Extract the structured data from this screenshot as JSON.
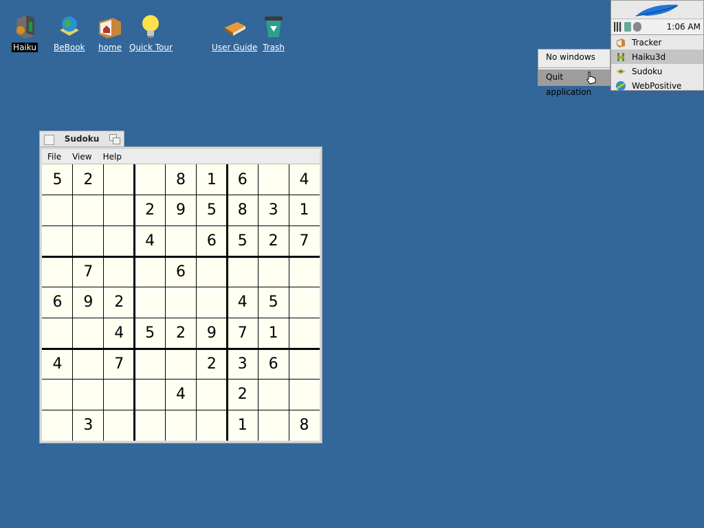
{
  "desktop": {
    "icons": [
      {
        "label": "Haiku",
        "icon": "haiku-volume-icon",
        "selected": true
      },
      {
        "label": "BeBook",
        "icon": "bebook-globe-icon"
      },
      {
        "label": "home",
        "icon": "home-folder-icon"
      },
      {
        "label": "Quick Tour",
        "icon": "lightbulb-icon"
      },
      {
        "label": "User Guide",
        "icon": "book-icon"
      },
      {
        "label": "Trash",
        "icon": "trash-icon"
      }
    ]
  },
  "deskbar": {
    "clock": "1:06 AM",
    "apps": [
      {
        "label": "Tracker",
        "icon": "tracker-icon"
      },
      {
        "label": "Haiku3d",
        "icon": "haiku3d-icon",
        "active": true
      },
      {
        "label": "Sudoku",
        "icon": "sudoku-icon"
      },
      {
        "label": "WebPositive",
        "icon": "webpositive-icon"
      }
    ]
  },
  "popup_menu": {
    "items": [
      "No windows",
      "Quit application"
    ]
  },
  "window": {
    "title": "Sudoku",
    "menu": [
      "File",
      "View",
      "Help"
    ]
  },
  "sudoku": {
    "grid": [
      [
        "5",
        "2",
        "",
        "",
        "8",
        "1",
        "6",
        "",
        "4"
      ],
      [
        "",
        "",
        "",
        "2",
        "9",
        "5",
        "8",
        "3",
        "1"
      ],
      [
        "",
        "",
        "",
        "4",
        "",
        "6",
        "5",
        "2",
        "7"
      ],
      [
        "",
        "7",
        "",
        "",
        "6",
        "",
        "",
        "",
        ""
      ],
      [
        "6",
        "9",
        "2",
        "",
        "",
        "",
        "4",
        "5",
        ""
      ],
      [
        "",
        "",
        "4",
        "5",
        "2",
        "9",
        "7",
        "1",
        ""
      ],
      [
        "4",
        "",
        "7",
        "",
        "",
        "2",
        "3",
        "6",
        ""
      ],
      [
        "",
        "",
        "",
        "",
        "4",
        "",
        "2",
        "",
        ""
      ],
      [
        "",
        "3",
        "",
        "",
        "",
        "",
        "1",
        "",
        "8"
      ]
    ]
  },
  "colors": {
    "desktop": "#336699",
    "grid_background": "#fffff2",
    "deskbar_leaf": "#1f77d6"
  }
}
